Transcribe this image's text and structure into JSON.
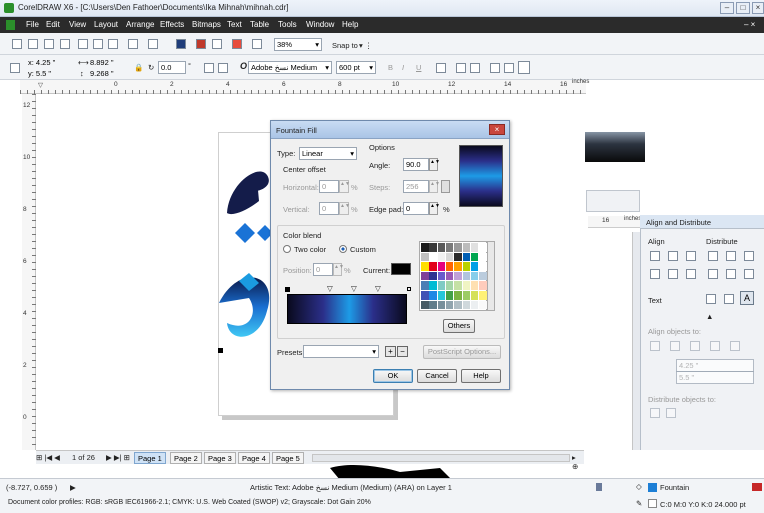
{
  "window": {
    "title": "CorelDRAW X6 - [C:\\Users\\Den Fathoer\\Documents\\Ika Mihnah\\mihnah.cdr]"
  },
  "menu": [
    "File",
    "Edit",
    "View",
    "Layout",
    "Arrange",
    "Effects",
    "Bitmaps",
    "Text",
    "Table",
    "Tools",
    "Window",
    "Help"
  ],
  "toolbar": {
    "zoom": "38%",
    "snap_to": "Snap to"
  },
  "propertybar": {
    "x": "x: 4.25 \"",
    "y": "y: 5.5 \"",
    "w": "8.892 \"",
    "h": "9.268 \"",
    "angle": "0.0",
    "font": "Adobe نسخ Medium",
    "size": "600 pt"
  },
  "ruler": {
    "unit": "inches",
    "h_ticks": [
      "0",
      "2",
      "4",
      "6",
      "8",
      "10",
      "12",
      "14",
      "16"
    ],
    "v_ticks": [
      "12",
      "10",
      "8",
      "6",
      "4",
      "2",
      "0"
    ]
  },
  "dialog": {
    "title": "Fountain Fill",
    "type_label": "Type:",
    "type_value": "Linear",
    "center_offset": "Center offset",
    "horizontal_label": "Horizontal:",
    "horizontal_value": "0",
    "vertical_label": "Vertical:",
    "vertical_value": "0",
    "percent": "%",
    "options_label": "Options",
    "angle_label": "Angle:",
    "angle_value": "90.0",
    "steps_label": "Steps:",
    "steps_value": "256",
    "edgepad_label": "Edge pad:",
    "edgepad_value": "0",
    "color_blend": "Color blend",
    "two_color": "Two color",
    "custom": "Custom",
    "position_label": "Position:",
    "position_value": "0",
    "current_label": "Current:",
    "others_button": "Others",
    "presets_label": "Presets:",
    "postscript_button": "PostScript Options...",
    "ok": "OK",
    "cancel": "Cancel",
    "help": "Help"
  },
  "docker": {
    "title": "Align and Distribute",
    "align": "Align",
    "distribute": "Distribute",
    "text": "Text",
    "align_objects_to": "Align objects to:",
    "x_val": "4.25 \"",
    "y_val": "5.5 \"",
    "distribute_objects_to": "Distribute objects to:"
  },
  "pages": {
    "counter": "1 of 26",
    "tabs": [
      "Page 1",
      "Page 2",
      "Page 3",
      "Page 4",
      "Page 5"
    ]
  },
  "status": {
    "coords": "(-8.727, 0.659 )",
    "object_info": "Artistic Text: Adobe نسخ Medium (Medium) (ARA) on Layer 1",
    "fill_name": "Fountain",
    "outline": "C:0 M:0 Y:0 K:0  24.000 pt",
    "color_profiles": "Document color profiles: RGB: sRGB IEC61966-2.1; CMYK: U.S. Web Coated (SWOP) v2; Grayscale: Dot Gain 20%"
  },
  "palette_colors": [
    "#1a1a1a",
    "#3a3a3a",
    "#5a5a5a",
    "#7a7a7a",
    "#9a9a9a",
    "#bcbcbc",
    "#e0e0e0",
    "#ffffff",
    "#c0c0c0",
    "#ffffff",
    "#f2f2f2",
    "#d9d9d9",
    "#2b2b2b",
    "#005fb4",
    "#00a650",
    "#ffffff",
    "#ffde00",
    "#e2001a",
    "#e6007e",
    "#ff6600",
    "#ffa000",
    "#b8d200",
    "#00a0e6",
    "#ffffff",
    "#7f3f98",
    "#2e3192",
    "#6a5acd",
    "#9b59b6",
    "#c1a0d8",
    "#b0c4de",
    "#87ceeb",
    "#bcd",
    "#4a7fb5",
    "#00bcd4",
    "#80cbc4",
    "#a5d6a7",
    "#c5e1a5",
    "#f0f4c3",
    "#ffe0b2",
    "#ffccbc",
    "#3f51b5",
    "#1e88e5",
    "#26c6da",
    "#43a047",
    "#7cb342",
    "#9ccc65",
    "#d4e157",
    "#fff176",
    "#455a64",
    "#607d8b",
    "#78909c",
    "#90a4ae",
    "#b0bec5",
    "#cfd8dc",
    "#eceff1",
    "#fafafa"
  ]
}
